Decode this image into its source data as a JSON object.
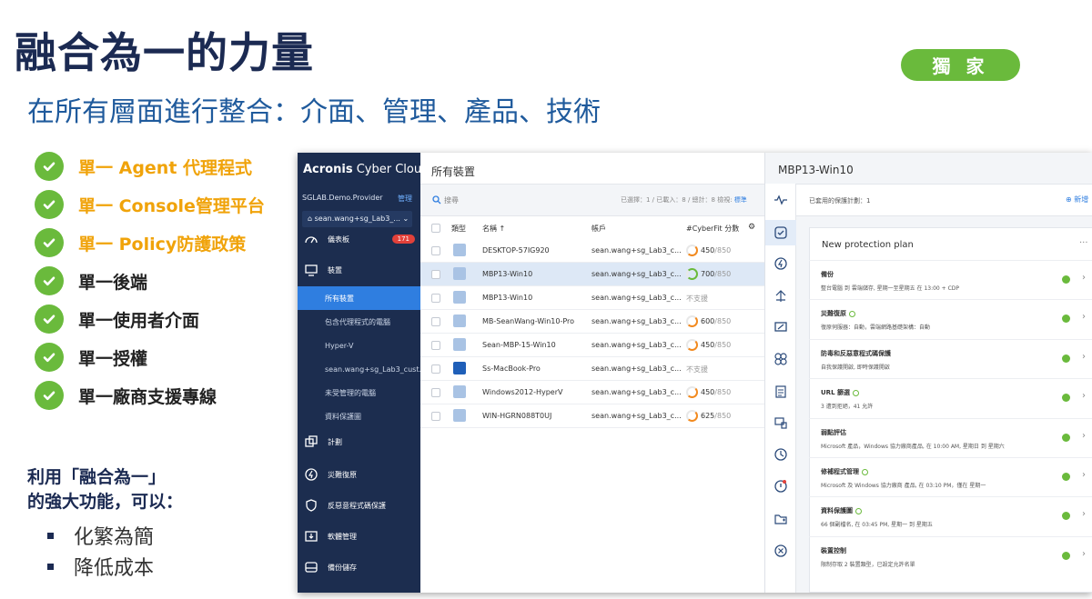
{
  "slide": {
    "title": "融合為一的力量",
    "subtitle": "在所有層面進行整合：介面、管理、產品、技術",
    "badge": "獨 家",
    "bullets": [
      {
        "text": "單一 Agent 代理程式",
        "highlight": true
      },
      {
        "text": "單一 Console管理平台",
        "highlight": true
      },
      {
        "text": "單一 Policy防護政策",
        "highlight": true
      },
      {
        "text": "單一後端",
        "highlight": false
      },
      {
        "text": "單一使用者介面",
        "highlight": false
      },
      {
        "text": "單一授權",
        "highlight": false
      },
      {
        "text": "單一廠商支援專線",
        "highlight": false
      }
    ],
    "use_line1": "利用「融合為一」",
    "use_line2": "的強大功能，可以：",
    "sub_items": [
      "化繁為簡",
      "降低成本"
    ],
    "colors": {
      "title": "#1b2a52",
      "subtitle": "#1f5a9c",
      "accent_green": "#6aba3c",
      "highlight_orange": "#f0a30a"
    }
  },
  "app": {
    "brand_a": "Acronis",
    "brand_b": " Cyber Cloud",
    "tenant": "SGLAB.Demo.Provider",
    "manage": "管理",
    "user": "sean.wang+sg_Lab3_...",
    "nav": [
      {
        "label": "儀表板",
        "icon": "dashboard-icon",
        "count": "171"
      },
      {
        "label": "裝置",
        "icon": "monitor-icon"
      },
      {
        "label": "所有裝置",
        "sub": true,
        "active": true
      },
      {
        "label": "包含代理程式的電腦",
        "sub": true
      },
      {
        "label": "Hyper-V",
        "sub": true
      },
      {
        "label": "sean.wang+sg_Lab3_cust...",
        "sub": true
      },
      {
        "label": "未受管理的電腦",
        "sub": true
      },
      {
        "label": "資料保護圖",
        "sub": true
      },
      {
        "label": "計劃",
        "icon": "plans-icon"
      },
      {
        "label": "災難復原",
        "icon": "disaster-recovery-icon"
      },
      {
        "label": "反惡意程式碼保護",
        "icon": "shield-icon"
      },
      {
        "label": "軟體管理",
        "icon": "software-icon"
      },
      {
        "label": "備份儲存",
        "icon": "storage-icon"
      }
    ],
    "devices": {
      "title": "所有裝置",
      "search_placeholder": "搜尋",
      "selinfo": "已選擇：1 / 已載入：8 / 總計：8  檢視:",
      "selinfo_link": "標準",
      "columns": {
        "type": "類型",
        "name": "名稱 ↑",
        "account": "帳戶",
        "score": "#CyberFit 分數"
      },
      "rows": [
        {
          "name": "DESKTOP-57IG920",
          "account": "sean.wang+sg_Lab3_c...",
          "score": "450",
          "max": "/850",
          "ring": "or",
          "type": "VM"
        },
        {
          "name": "MBP13-Win10",
          "account": "sean.wang+sg_Lab3_c...",
          "score": "700",
          "max": "/850",
          "ring": "gr",
          "type": "PC",
          "selected": true
        },
        {
          "name": "MBP13-Win10",
          "account": "sean.wang+sg_Lab3_c...",
          "score": "不支援",
          "type": "PC"
        },
        {
          "name": "MB-SeanWang-Win10-Pro",
          "account": "sean.wang+sg_Lab3_c...",
          "score": "600",
          "max": "/850",
          "ring": "or",
          "type": "VM"
        },
        {
          "name": "Sean-MBP-15-Win10",
          "account": "sean.wang+sg_Lab3_c...",
          "score": "450",
          "max": "/850",
          "ring": "or",
          "type": "PC"
        },
        {
          "name": "Ss-MacBook-Pro",
          "account": "sean.wang+sg_Lab3_c...",
          "score": "不支援",
          "type": "MAC"
        },
        {
          "name": "Windows2012-HyperV",
          "account": "sean.wang+sg_Lab3_c...",
          "score": "450",
          "max": "/850",
          "ring": "or",
          "type": "VM"
        },
        {
          "name": "WIN-HGRN088T0UJ",
          "account": "sean.wang+sg_Lab3_c...",
          "score": "625",
          "max": "/850",
          "ring": "or",
          "type": "VM"
        }
      ]
    },
    "detail": {
      "title": "MBP13-Win10",
      "applied": "已套用的保護計劃：1",
      "add_new": "新增",
      "plan_name": "New protection plan",
      "more": "···",
      "rows": [
        {
          "title": "備份",
          "desc": "整台電腦 到 雲端儲存, 星期一至星期五 在 13:00 + CDP"
        },
        {
          "title": "災難復原",
          "desc": "復原伺服器：自動，雲端網路基礎架構：自動",
          "small_ok": true
        },
        {
          "title": "防毒和反惡意程式碼保護",
          "desc": "自我保護開啟, 即時保護開啟"
        },
        {
          "title": "URL 篩選",
          "desc": "3 遭到拒絕，41 允許",
          "small_ok": true
        },
        {
          "title": "弱點評估",
          "desc": "Microsoft 產品，Windows 協力廠商產品, 在 10:00 AM, 星期日 到 星期六"
        },
        {
          "title": "修補程式管理",
          "desc": "Microsoft 及 Windows 協力廠商 產品, 在 03:10 PM，僅在 星期一",
          "small_ok": true
        },
        {
          "title": "資料保護圖",
          "desc": "66 個副檔名, 在 03:45 PM, 星期一 到 星期五",
          "small_ok": true
        },
        {
          "title": "裝置控制",
          "desc": "限制存取 2 裝置類型，已設定允許名單"
        }
      ],
      "rail_icons": [
        "activity-icon",
        "shield-check-icon",
        "bolt-icon",
        "network-icon",
        "vulnerability-icon",
        "patch-icon",
        "list-icon",
        "devices-icon",
        "clock-icon",
        "alert-icon",
        "folder-icon",
        "block-icon"
      ]
    }
  }
}
